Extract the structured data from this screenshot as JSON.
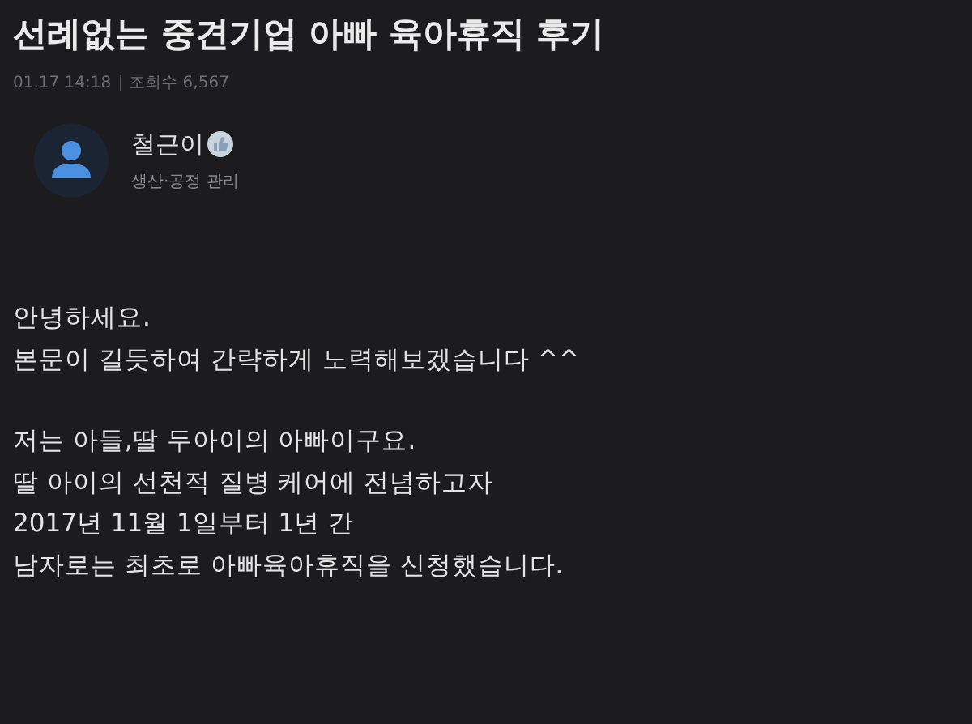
{
  "post": {
    "title": "선례없는 중견기업 아빠 육아휴직 후기",
    "date": "01.17 14:18",
    "views": "조회수 6,567"
  },
  "author": {
    "name": "철근이",
    "role": "생산·공정 관리"
  },
  "body": [
    [
      "안녕하세요.",
      "본문이 길듯하여 간략하게 노력해보겠습니다 ^^"
    ],
    [
      "저는 아들,딸 두아이의 아빠이구요.",
      "딸 아이의 선천적 질병 케어에 전념하고자",
      "2017년 11월 1일부터 1년 간",
      "남자로는 최초로 아빠육아휴직을 신청했습니다."
    ]
  ]
}
